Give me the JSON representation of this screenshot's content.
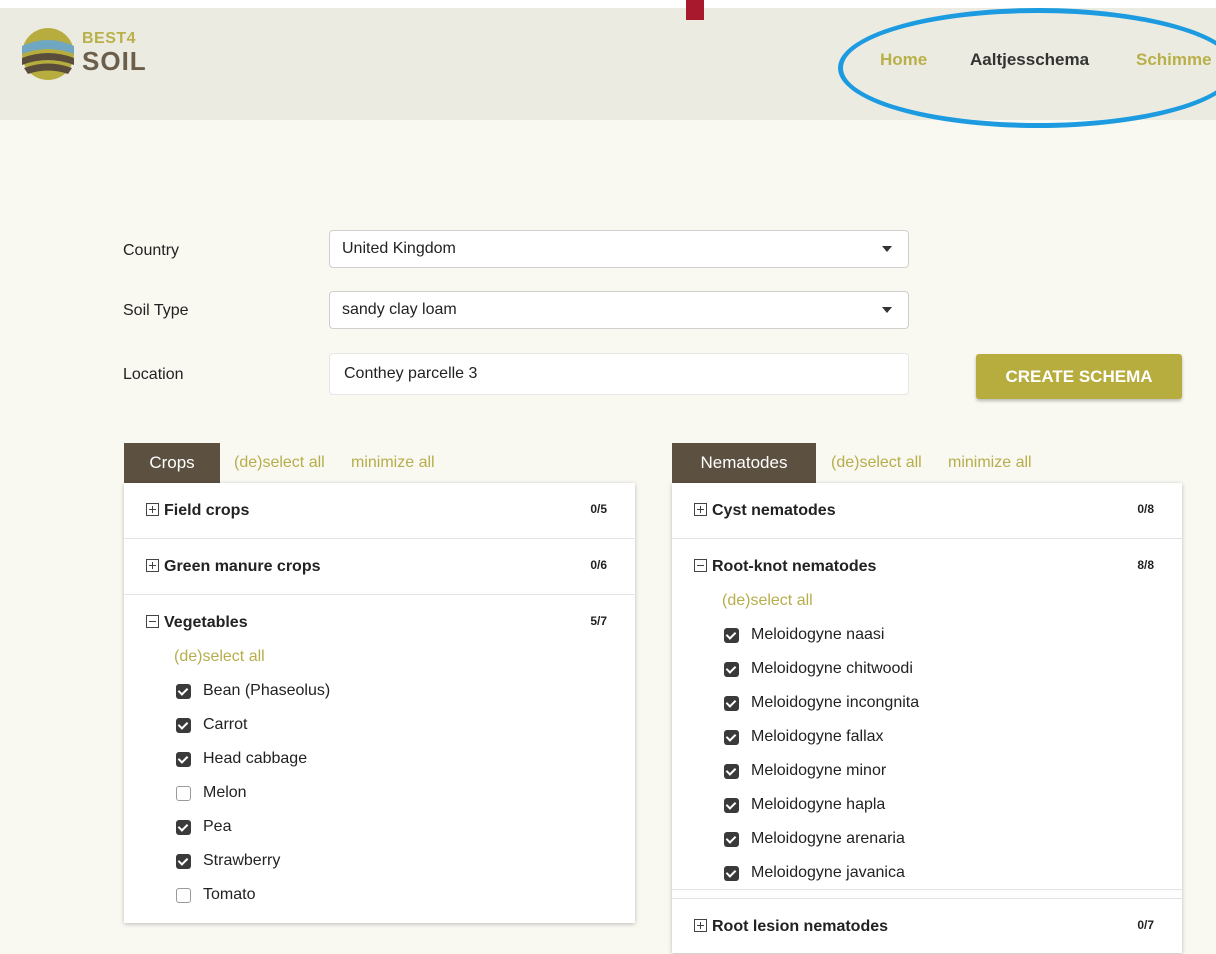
{
  "brand": {
    "line1": "BEST4",
    "line2": "SOIL"
  },
  "nav": {
    "items": [
      {
        "label": "Home",
        "color": "#b9b04a"
      },
      {
        "label": "Aaltjesschema",
        "color": "#333333"
      },
      {
        "label": "Schimme",
        "color": "#b9b04a"
      }
    ]
  },
  "form": {
    "country_label": "Country",
    "country_value": "United Kingdom",
    "soil_label": "Soil Type",
    "soil_value": "sandy clay loam",
    "location_label": "Location",
    "location_value": "Conthey parcelle 3",
    "create_label": "CREATE SCHEMA"
  },
  "crops": {
    "tab": "Crops",
    "deselect_all": "(de)select all",
    "minimize_all": "minimize all",
    "sections": [
      {
        "title": "Field crops",
        "count": "0/5",
        "expanded": false
      },
      {
        "title": "Green manure crops",
        "count": "0/6",
        "expanded": false
      },
      {
        "title": "Vegetables",
        "count": "5/7",
        "expanded": true,
        "select_all": "(de)select all",
        "items": [
          {
            "label": "Bean (Phaseolus)",
            "checked": true
          },
          {
            "label": "Carrot",
            "checked": true
          },
          {
            "label": "Head cabbage",
            "checked": true
          },
          {
            "label": "Melon",
            "checked": false
          },
          {
            "label": "Pea",
            "checked": true
          },
          {
            "label": "Strawberry",
            "checked": true
          },
          {
            "label": "Tomato",
            "checked": false
          }
        ]
      }
    ]
  },
  "nematodes": {
    "tab": "Nematodes",
    "deselect_all": "(de)select all",
    "minimize_all": "minimize all",
    "sections": [
      {
        "title": "Cyst nematodes",
        "count": "0/8",
        "expanded": false
      },
      {
        "title": "Root-knot nematodes",
        "count": "8/8",
        "expanded": true,
        "select_all": "(de)select all",
        "items": [
          {
            "label": "Meloidogyne naasi",
            "checked": true
          },
          {
            "label": "Meloidogyne chitwoodi",
            "checked": true
          },
          {
            "label": "Meloidogyne incongnita",
            "checked": true
          },
          {
            "label": "Meloidogyne fallax",
            "checked": true
          },
          {
            "label": "Meloidogyne minor",
            "checked": true
          },
          {
            "label": "Meloidogyne hapla",
            "checked": true
          },
          {
            "label": "Meloidogyne arenaria",
            "checked": true
          },
          {
            "label": "Meloidogyne javanica",
            "checked": true
          }
        ]
      },
      {
        "title": "Root lesion nematodes",
        "count": "0/7",
        "expanded": false
      }
    ]
  },
  "colors": {
    "accent": "#b7ad3f",
    "tab_bg": "#5c5040",
    "highlight_ellipse": "#1d9be0"
  }
}
